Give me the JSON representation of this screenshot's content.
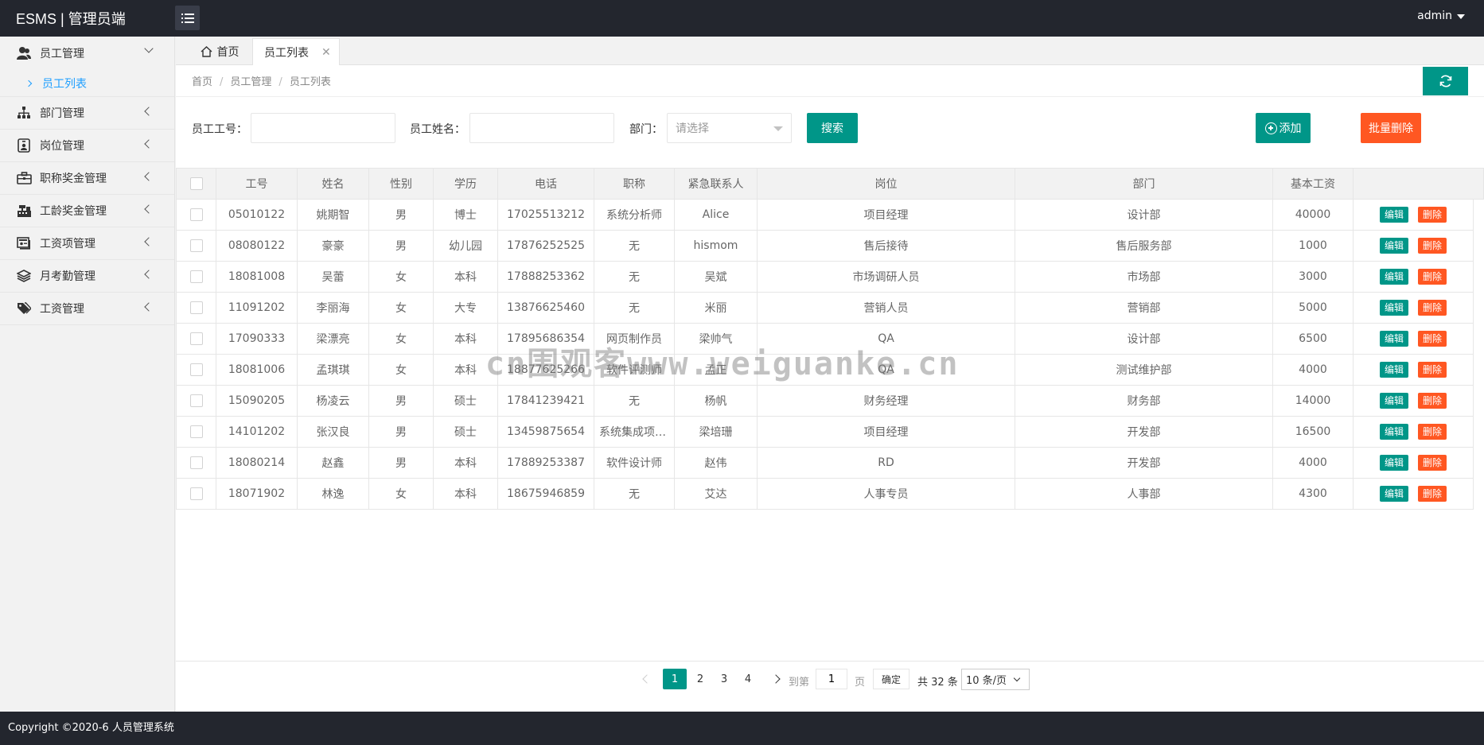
{
  "app": {
    "title": "ESMS | 管理员端",
    "user": "admin"
  },
  "sidebar": {
    "items": [
      {
        "label": "员工管理",
        "icon": "users-icon",
        "open": true
      },
      {
        "label": "部门管理",
        "icon": "sitemap-icon"
      },
      {
        "label": "岗位管理",
        "icon": "badge-icon"
      },
      {
        "label": "职称奖金管理",
        "icon": "briefcase-icon"
      },
      {
        "label": "工龄奖金管理",
        "icon": "cash-register-icon"
      },
      {
        "label": "工资项管理",
        "icon": "id-card-icon"
      },
      {
        "label": "月考勤管理",
        "icon": "layers-icon"
      },
      {
        "label": "工资管理",
        "icon": "tags-icon"
      }
    ],
    "subitem": "员工列表"
  },
  "tabs": {
    "home": "首页",
    "active": "员工列表"
  },
  "breadcrumb": [
    "首页",
    "员工管理",
    "员工列表"
  ],
  "search": {
    "id_label": "员工工号：",
    "name_label": "员工姓名：",
    "dept_label": "部门：",
    "dept_placeholder": "请选择",
    "search_btn": "搜索",
    "add_btn": "添加",
    "batch_delete_btn": "批量删除"
  },
  "table": {
    "headers": [
      "工号",
      "姓名",
      "性别",
      "学历",
      "电话",
      "职称",
      "紧急联系人",
      "岗位",
      "部门",
      "基本工资"
    ],
    "edit_label": "编辑",
    "delete_label": "删除",
    "rows": [
      [
        "05010122",
        "姚期智",
        "男",
        "博士",
        "17025513212",
        "系统分析师",
        "Alice",
        "项目经理",
        "设计部",
        "40000"
      ],
      [
        "08080122",
        "豪豪",
        "男",
        "幼儿园",
        "17876252525",
        "无",
        "hismom",
        "售后接待",
        "售后服务部",
        "1000"
      ],
      [
        "18081008",
        "吴蕾",
        "女",
        "本科",
        "17888253362",
        "无",
        "吴斌",
        "市场调研人员",
        "市场部",
        "3000"
      ],
      [
        "11091202",
        "李丽海",
        "女",
        "大专",
        "13876625460",
        "无",
        "米丽",
        "营销人员",
        "营销部",
        "5000"
      ],
      [
        "17090333",
        "梁漂亮",
        "女",
        "本科",
        "17895686354",
        "网页制作员",
        "梁帅气",
        "QA",
        "设计部",
        "6500"
      ],
      [
        "18081006",
        "孟琪琪",
        "女",
        "本科",
        "18877625266",
        "软件评测师",
        "孟正",
        "QA",
        "测试维护部",
        "4000"
      ],
      [
        "15090205",
        "杨凌云",
        "男",
        "硕士",
        "17841239421",
        "无",
        "杨帆",
        "财务经理",
        "财务部",
        "14000"
      ],
      [
        "14101202",
        "张汉良",
        "男",
        "硕士",
        "13459875654",
        "系统集成项目管理工程师",
        "梁培珊",
        "项目经理",
        "开发部",
        "16500"
      ],
      [
        "18080214",
        "赵鑫",
        "男",
        "本科",
        "17889253387",
        "软件设计师",
        "赵伟",
        "RD",
        "开发部",
        "4000"
      ],
      [
        "18071902",
        "林逸",
        "女",
        "本科",
        "18675946859",
        "无",
        "艾达",
        "人事专员",
        "人事部",
        "4300"
      ]
    ]
  },
  "pager": {
    "pages": [
      "1",
      "2",
      "3",
      "4"
    ],
    "current": "1",
    "goto_label": "到第",
    "goto_value": "1",
    "page_unit": "页",
    "confirm": "确定",
    "total": "共 32 条",
    "per_page": "10 条/页"
  },
  "footer": "Copyright ©2020-6 人员管理系统",
  "watermark": "cn围观客www.weiguanke.cn",
  "colors": {
    "header": "#23262e",
    "primary": "#009688",
    "danger": "#ff5722",
    "link": "#1e9fff"
  }
}
